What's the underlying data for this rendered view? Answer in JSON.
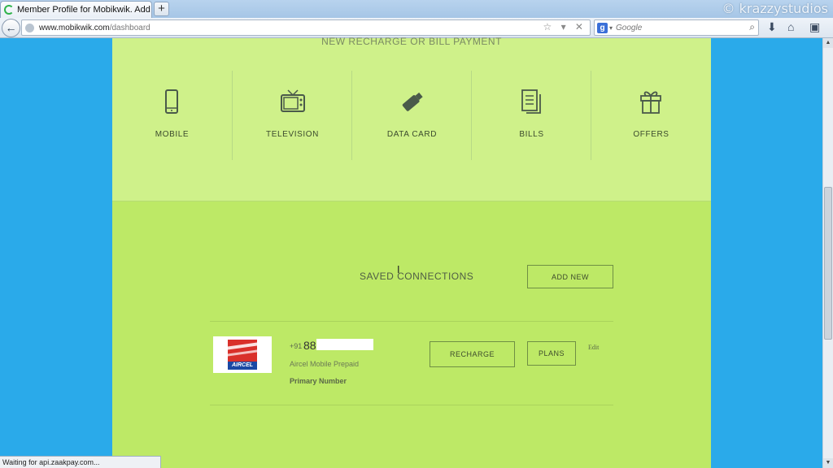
{
  "browser": {
    "tab_title": "Member Profile for Mobikwik. Add new ...",
    "new_tab_label": "+",
    "watermark": "© krazzystudios",
    "back_label": "←",
    "url_host": "www.mobikwik.com",
    "url_path": "/dashboard",
    "url_icons": "☆ ▾ ✕",
    "search_engine_letter": "g",
    "search_placeholder": "Google",
    "search_icon": "⌕",
    "download_icon": "⬇",
    "home_icon": "⌂",
    "menu_icon": "▣"
  },
  "recharge": {
    "heading": "NEW RECHARGE  OR  BILL PAYMENT",
    "services": [
      {
        "label": "MOBILE",
        "icon": "mobile-icon"
      },
      {
        "label": "TELEVISION",
        "icon": "television-icon"
      },
      {
        "label": "DATA  CARD",
        "icon": "data-card-icon"
      },
      {
        "label": "BILLS",
        "icon": "bills-icon"
      },
      {
        "label": "OFFERS",
        "icon": "gift-icon"
      }
    ]
  },
  "saved": {
    "title": "SAVED CONNECTIONS",
    "add_new_label": "ADD  NEW",
    "connection": {
      "logo_text": "AIRCEL",
      "country_code": "+91",
      "number_visible": "88",
      "operator": "Aircel Mobile Prepaid",
      "tag": "Primary Number",
      "recharge_label": "RECHARGE",
      "plans_label": "PLANS",
      "edit_label": "Edit"
    }
  },
  "status": "Waiting for api.zaakpay.com...",
  "colors": {
    "page_bg": "#2aaaea",
    "panel_light": "#cff18a",
    "panel_main": "#bde966"
  }
}
